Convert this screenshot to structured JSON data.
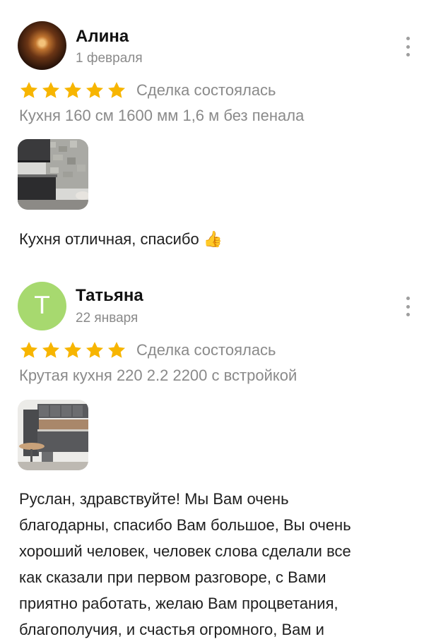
{
  "reviews": [
    {
      "author": "Алина",
      "date": "1 февраля",
      "rating": 5,
      "deal_status": "Сделка состоялась",
      "product": "Кухня 160 см 1600 мм 1,6 м без пенала",
      "text": "Кухня отличная, спасибо",
      "emoji": "👍"
    },
    {
      "author": "Татьяна",
      "avatar_letter": "T",
      "date": "22 января",
      "rating": 5,
      "deal_status": "Сделка состоялась",
      "product": "Крутая кухня 220 2.2 2200 с встройкой",
      "text_lines": [
        "Руслан, здравствуйте! Мы Вам очень",
        "благодарны, спасибо Вам большое, Вы очень",
        "хороший человек, человек слова сделали все",
        "как сказали при первом разговоре, с Вами",
        "приятно работать, желаю Вам процветания,",
        "благополучия, и счастья огромного, Вам и"
      ]
    }
  ],
  "colors": {
    "star": "#f7b500",
    "avatar_letter_bg": "#a7d96f",
    "muted_text": "#8a8a8a"
  }
}
